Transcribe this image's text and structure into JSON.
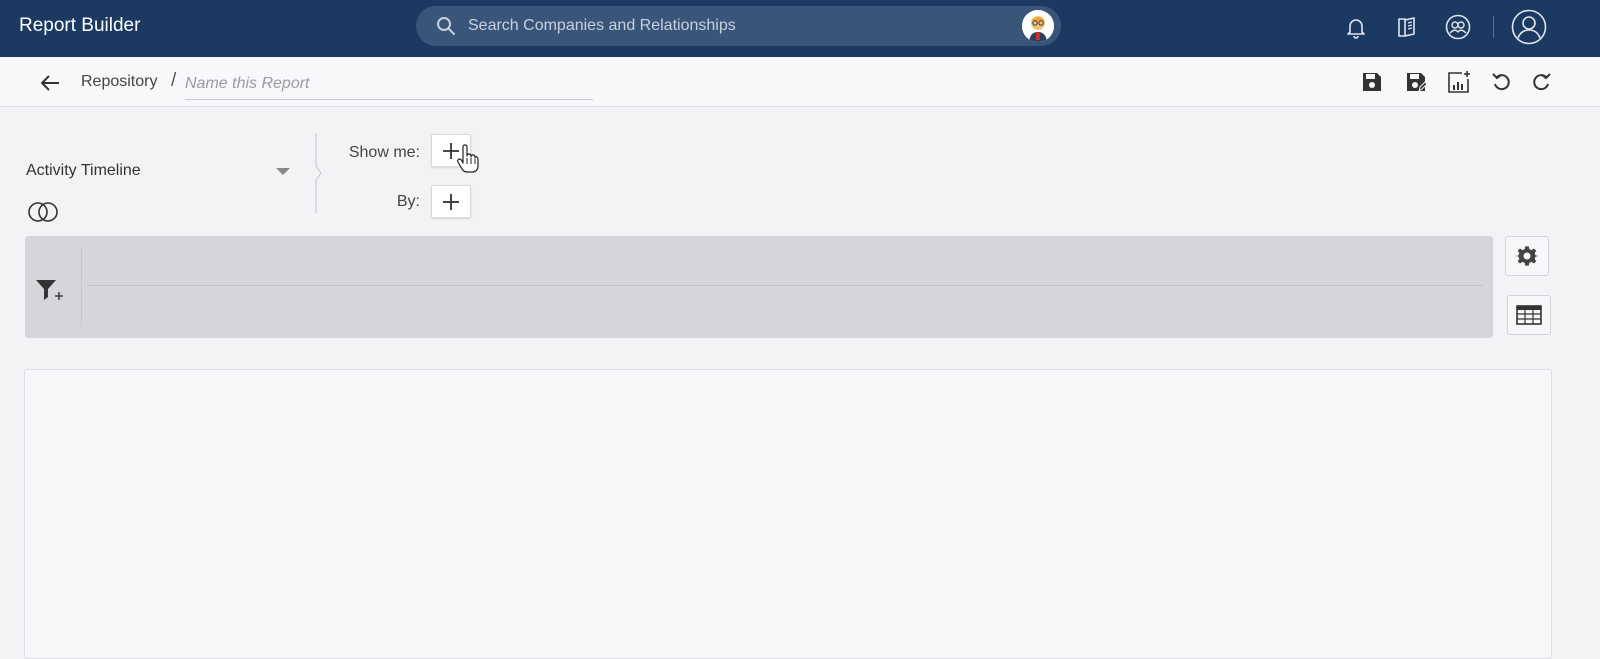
{
  "topbar": {
    "title": "Report Builder",
    "search_placeholder": "Search Companies and Relationships",
    "icons": [
      "search-icon",
      "bot-avatar-icon",
      "bell-icon",
      "book-icon",
      "people-icon",
      "user-profile-icon"
    ],
    "background": "#1c3a61"
  },
  "subbar": {
    "breadcrumb": "Repository",
    "separator": "/",
    "name_placeholder": "Name this Report",
    "name_value": "",
    "tools": [
      "save-icon",
      "save-as-icon",
      "add-to-dashboard-icon",
      "undo-icon",
      "redo-icon"
    ]
  },
  "builder": {
    "source": "Activity Timeline",
    "show_me_label": "Show me:",
    "by_label": "By:"
  },
  "filter_panel": {
    "icons": [
      "filter-add-icon"
    ],
    "background": "#d6d6da"
  },
  "side_tools": [
    "gear-icon",
    "table-icon"
  ]
}
